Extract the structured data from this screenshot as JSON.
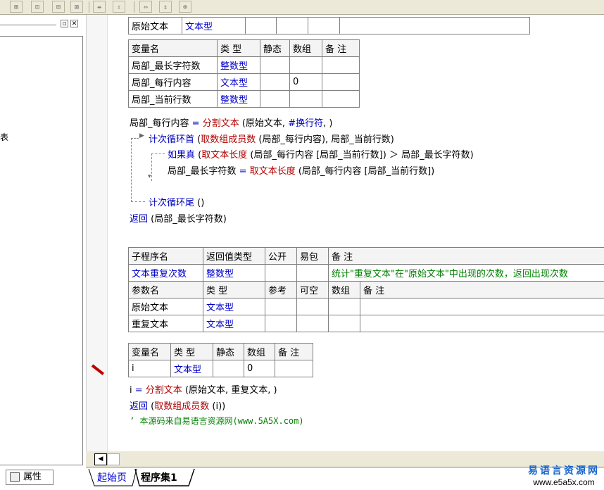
{
  "left_panel": {
    "fragment": "表",
    "property_tab": "属性"
  },
  "editor": {
    "table0": {
      "col1": "原始文本",
      "col2": "文本型"
    },
    "vars1": {
      "headers": [
        "变量名",
        "类 型",
        "静态",
        "数组",
        "备 注"
      ],
      "rows": [
        {
          "name": "局部_最长字符数",
          "type": "整数型",
          "array": ""
        },
        {
          "name": "局部_每行内容",
          "type": "文本型",
          "array": "0"
        },
        {
          "name": "局部_当前行数",
          "type": "整数型",
          "array": ""
        }
      ]
    },
    "code1": {
      "l1": {
        "var": "局部_每行内容",
        "eq": " = ",
        "fn": "分割文本",
        "args": " (原始文本, ",
        "const": "#换行符",
        "end": ", )"
      },
      "l2": {
        "kw": "计次循环首",
        "p1": " (",
        "fn": "取数组成员数",
        "args": " (局部_每行内容), 局部_当前行数)"
      },
      "l3": {
        "kw": "如果真",
        "p1": " (",
        "fn": "取文本长度",
        "args": " (局部_每行内容 [局部_当前行数]) ＞ 局部_最长字符数)"
      },
      "l4": {
        "var": "局部_最长字符数",
        "eq": " = ",
        "fn": "取文本长度",
        "args": " (局部_每行内容 [局部_当前行数])"
      },
      "l5": {
        "kw": "计次循环尾",
        "args": " ()"
      },
      "l6": {
        "kw": "返回",
        "args": " (局部_最长字符数)"
      }
    },
    "sub": {
      "headers": [
        "子程序名",
        "返回值类型",
        "公开",
        "易包",
        "备 注"
      ],
      "name": "文本重复次数",
      "ret": "整数型",
      "remark": "统计\"重复文本\"在\"原始文本\"中出现的次数，返回出现次数",
      "param_headers": [
        "参数名",
        "类 型",
        "参考",
        "可空",
        "数组",
        "备 注"
      ],
      "params": [
        {
          "name": "原始文本",
          "type": "文本型"
        },
        {
          "name": "重复文本",
          "type": "文本型"
        }
      ]
    },
    "vars2": {
      "headers": [
        "变量名",
        "类 型",
        "静态",
        "数组",
        "备 注"
      ],
      "row": {
        "name": "i",
        "type": "文本型",
        "array": "0"
      }
    },
    "code2": {
      "l1": {
        "var": "i",
        "eq": " = ",
        "fn": "分割文本",
        "args": " (原始文本, 重复文本, )"
      },
      "l2": {
        "kw": "返回",
        "p1": " (",
        "fn": "取数组成员数",
        "args": " (i))"
      },
      "l3": "’ 本源码来自易语言资源网(www.5A5X.com)"
    }
  },
  "tabs": [
    "起始页",
    "程序集1"
  ],
  "watermark": {
    "title": "易语言资源网",
    "url": "www.e5a5x.com"
  }
}
